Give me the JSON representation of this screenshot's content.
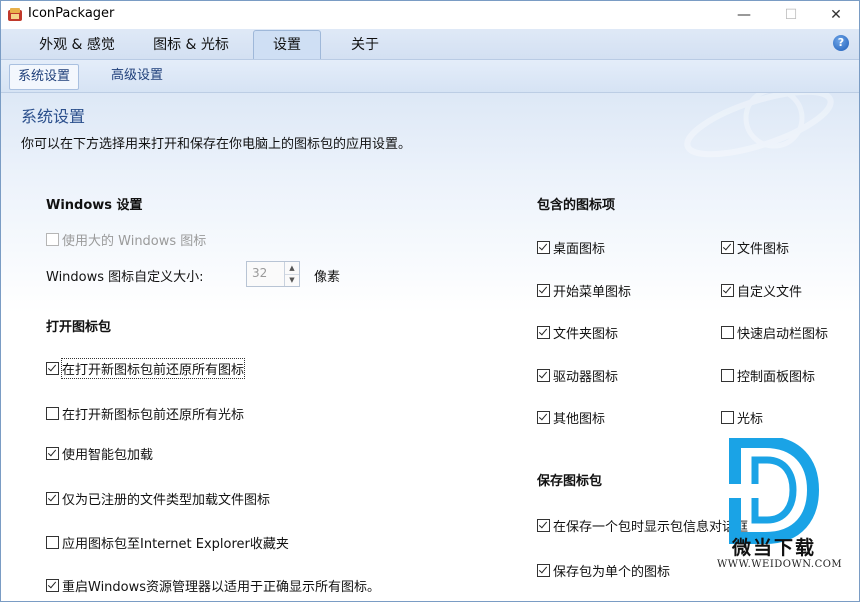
{
  "window": {
    "title": "IconPackager",
    "min_label": "—",
    "max_label": "☐",
    "close_label": "✕"
  },
  "tabs": [
    {
      "label": "外观 & 感觉",
      "active": false
    },
    {
      "label": "图标 & 光标",
      "active": false
    },
    {
      "label": "设置",
      "active": true
    },
    {
      "label": "关于",
      "active": false
    }
  ],
  "help_label": "?",
  "subtabs": [
    {
      "label": "系统设置",
      "active": true
    },
    {
      "label": "高级设置",
      "active": false
    }
  ],
  "page": {
    "title": "系统设置",
    "description": "你可以在下方选择用来打开和保存在你电脑上的图标包的应用设置。"
  },
  "windows_settings": {
    "heading": "Windows 设置",
    "large_icons": {
      "label": "使用大的 Windows 图标",
      "checked": false,
      "disabled": true
    },
    "size_label": "Windows 图标自定义大小:",
    "size_value": "32",
    "size_unit": "像素"
  },
  "open_pack": {
    "heading": "打开图标包",
    "options": [
      {
        "label": "在打开新图标包前还原所有图标",
        "checked": true
      },
      {
        "label": "在打开新图标包前还原所有光标",
        "checked": false
      },
      {
        "label": "使用智能包加载",
        "checked": true
      },
      {
        "label": "仅为已注册的文件类型加载文件图标",
        "checked": true
      },
      {
        "label": "应用图标包至Internet Explorer收藏夹",
        "checked": false
      },
      {
        "label": "重启Windows资源管理器以适用于正确显示所有图标。",
        "checked": true
      }
    ]
  },
  "included_items": {
    "heading": "包含的图标项",
    "left": [
      {
        "label": "桌面图标",
        "checked": true
      },
      {
        "label": "开始菜单图标",
        "checked": true
      },
      {
        "label": "文件夹图标",
        "checked": true
      },
      {
        "label": "驱动器图标",
        "checked": true
      },
      {
        "label": "其他图标",
        "checked": true
      }
    ],
    "right": [
      {
        "label": "文件图标",
        "checked": true
      },
      {
        "label": "自定义文件",
        "checked": true
      },
      {
        "label": "快速启动栏图标",
        "checked": false
      },
      {
        "label": "控制面板图标",
        "checked": false
      },
      {
        "label": "光标",
        "checked": false
      }
    ]
  },
  "save_pack": {
    "heading": "保存图标包",
    "options": [
      {
        "label": "在保存一个包时显示包信息对话框",
        "checked": true
      },
      {
        "label": "保存包为单个的图标",
        "checked": true
      }
    ]
  },
  "watermark": {
    "name": "微当下载",
    "url": "WWW.WEIDOWN.COM"
  }
}
